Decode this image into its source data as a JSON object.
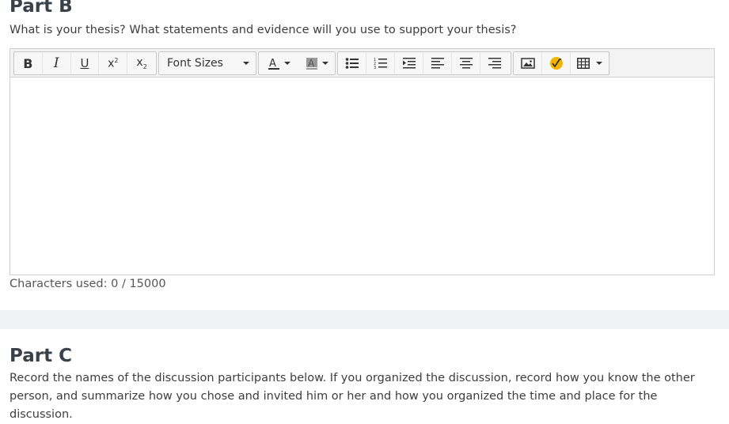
{
  "part_b": {
    "title": "Part B",
    "prompt": "What is your thesis? What statements and evidence will you use to support your thesis?",
    "editor": {
      "font_sizes_label": "Font Sizes",
      "content": "",
      "characters_used": "Characters used: 0 / 15000"
    }
  },
  "part_c": {
    "title": "Part C",
    "prompt": "Record the names of the discussion participants below. If you organized the discussion, record how you know the other person, and summarize how you chose and invited him or her and how you organized the time and place for the discussion."
  },
  "icons": {
    "bold": "bold-icon",
    "italic": "italic-icon",
    "underline": "underline-icon",
    "superscript": "superscript-icon",
    "subscript": "subscript-icon",
    "text_color": "text-color-icon",
    "highlight": "highlight-color-icon",
    "bulleted_list": "bulleted-list-icon",
    "numbered_list": "numbered-list-icon",
    "indent": "indent-icon",
    "align_left": "align-left-icon",
    "align_center": "align-center-icon",
    "align_right": "align-right-icon",
    "image": "image-icon",
    "math": "math-formula-icon",
    "table": "table-icon"
  },
  "colors": {
    "text_color_swatch": "#333333",
    "highlight_swatch": "#9a9a9a",
    "math_icon": "#f4b400"
  }
}
